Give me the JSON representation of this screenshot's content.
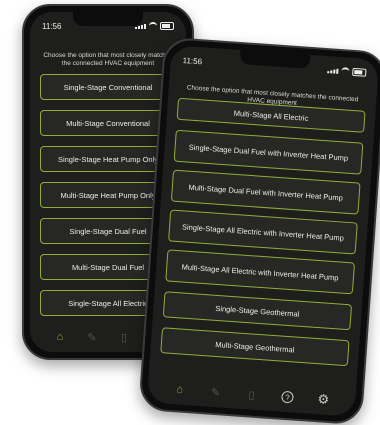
{
  "left_phone": {
    "status": {
      "time": "11:56"
    },
    "prompt": "Choose the option that most closely matches the connected HVAC equipment",
    "options": [
      "Single-Stage Conventional",
      "Multi-Stage Conventional",
      "Single-Stage Heat Pump Only",
      "Multi-Stage Heat Pump Only",
      "Single-Stage Dual Fuel",
      "Multi-Stage Dual Fuel",
      "Single-Stage All Electric"
    ],
    "tabs": [
      "home-icon",
      "wrench-icon",
      "document-icon",
      "help-icon"
    ]
  },
  "right_phone": {
    "status": {
      "time": "11:56"
    },
    "prompt": "Choose the option that most closely matches the connected HVAC equipment",
    "options": [
      "Multi-Stage All Electric",
      "Single-Stage Dual Fuel with Inverter Heat Pump",
      "Multi-Stage Dual Fuel with Inverter Heat Pump",
      "Single-Stage All Electric with Inverter Heat Pump",
      "Multi-Stage All Electric with Inverter Heat Pump",
      "Single-Stage Geothermal",
      "Multi-Stage Geothermal"
    ],
    "tabs": [
      "home-icon",
      "wrench-icon",
      "document-icon",
      "help-icon",
      "gear-icon"
    ]
  },
  "colors": {
    "accent": "#8fae3a",
    "screen_bg": "#1e1f1c",
    "button_bg": "#272825"
  }
}
